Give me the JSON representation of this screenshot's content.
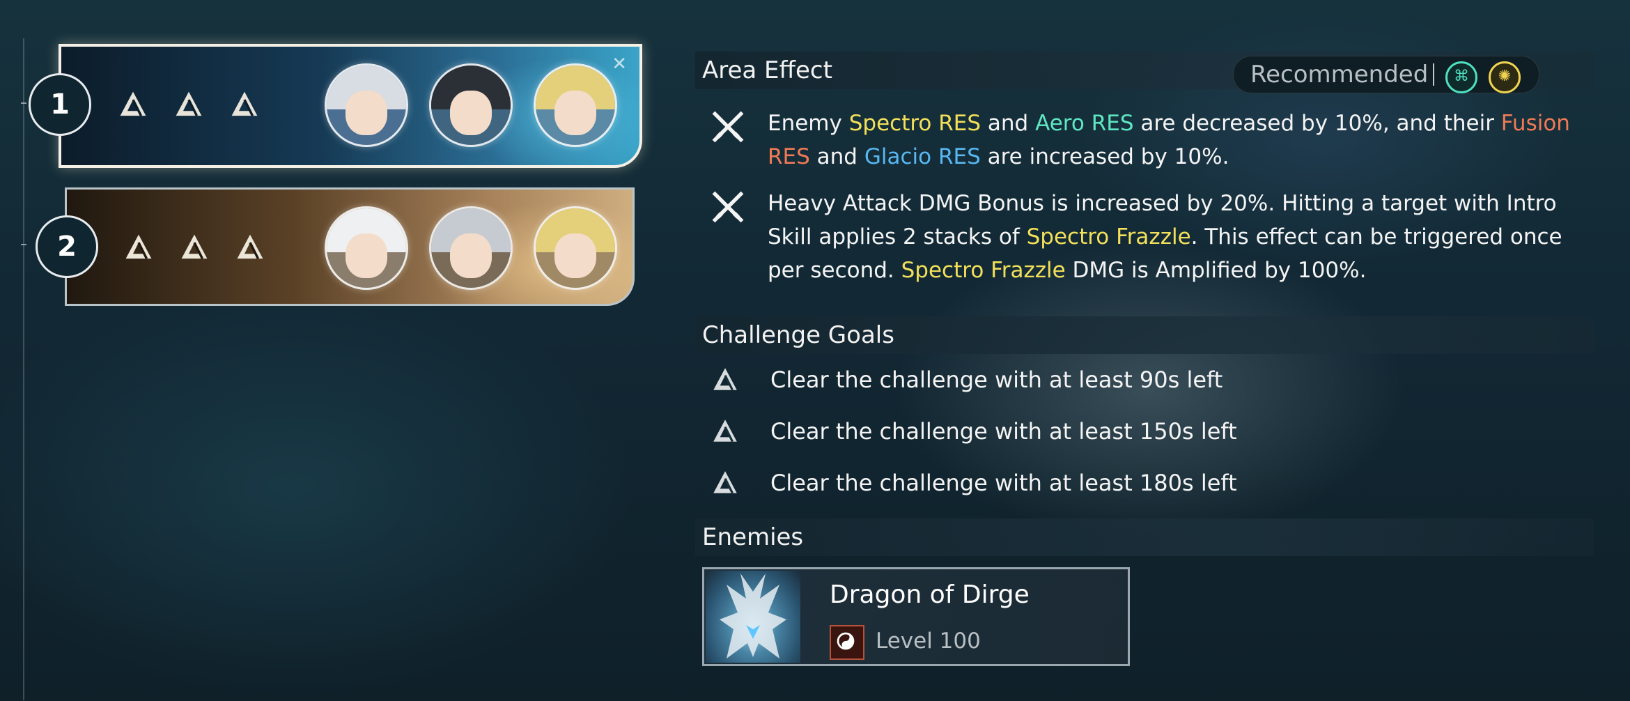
{
  "teams": [
    {
      "number": "1",
      "state": "selected",
      "goals_completed": 3
    },
    {
      "number": "2",
      "state": "normal",
      "goals_completed": 3
    }
  ],
  "area_effect": {
    "title": "Area Effect",
    "recommended_label": "Recommended",
    "recommended_elements": [
      "aero-icon",
      "spectro-icon"
    ],
    "effects": [
      {
        "parts": [
          "Enemy ",
          "Spectro RES",
          " and ",
          "Aero RES",
          " are decreased by 10%, and their ",
          "Fusion RES",
          " and ",
          "Glacio RES",
          " are increased by 10%."
        ]
      },
      {
        "parts": [
          "Heavy Attack DMG Bonus is increased by 20%. Hitting a target with Intro Skill applies 2 stacks of ",
          "Spectro Frazzle",
          ". This effect can be triggered once per second. ",
          "Spectro Frazzle",
          " DMG is Amplified by 100%."
        ]
      }
    ]
  },
  "challenge_goals": {
    "title": "Challenge Goals",
    "goals": [
      "Clear the challenge with at least 90s left",
      "Clear the challenge with at least 150s left",
      "Clear the challenge with at least 180s left"
    ]
  },
  "enemies": {
    "title": "Enemies",
    "list": [
      {
        "name": "Dragon of Dirge",
        "level": "Level 100"
      }
    ]
  },
  "colors": {
    "spectro": "#f3e05a",
    "aero": "#5fe6c2",
    "fusion": "#f07a55",
    "glacio": "#58b8f2"
  }
}
